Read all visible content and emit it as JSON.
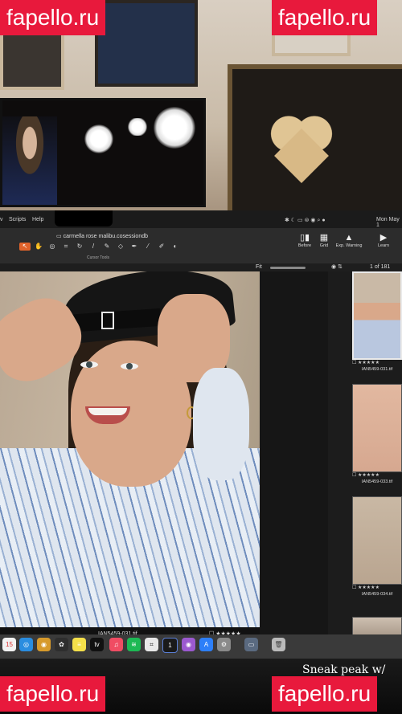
{
  "watermarks": {
    "top_left": "fapello.ru",
    "top_right": "fapello.ru",
    "bottom_left": "fapello.ru",
    "bottom_right": "fapello.ru"
  },
  "menubar": {
    "items": [
      "v",
      "Scripts",
      "Help"
    ],
    "clock": "Mon May 1"
  },
  "window": {
    "title": "carmella rose malibu.cosessiondb"
  },
  "toolbar": {
    "tools": [
      "cursor",
      "hand",
      "loupe",
      "crop",
      "rotate",
      "straighten",
      "brush",
      "eraser",
      "pen",
      "pipette",
      "pencil",
      "gradient"
    ],
    "group_label": "Cursor Tools",
    "right": [
      {
        "label": "Before",
        "icon": "before-icon"
      },
      {
        "label": "Grid",
        "icon": "grid-icon"
      },
      {
        "label": "Exp. Warning",
        "icon": "warning-icon"
      },
      {
        "label": "Learn",
        "icon": "learn-icon"
      }
    ]
  },
  "viewer": {
    "zoom": "Fit",
    "counter": "1 of 181",
    "filename": "IAN5459-031.tif",
    "rating": "★★★★★"
  },
  "filmstrip": [
    {
      "name": "IAN5459-031.tif",
      "stars": "★★★★★",
      "selected": true
    },
    {
      "name": "IAN5459-033.tif",
      "stars": "★★★★★",
      "selected": false
    },
    {
      "name": "IAN5459-034.tif",
      "stars": "★★★★★",
      "selected": false
    }
  ],
  "dock": {
    "calendar_day": "15"
  },
  "overlay_text": "Sneak peak w/",
  "colors": {
    "watermark": "#e8193c",
    "active_tool": "#e0632b"
  }
}
